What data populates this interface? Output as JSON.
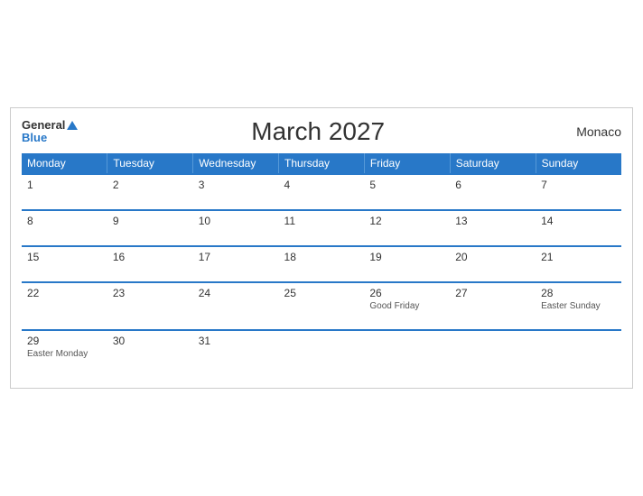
{
  "header": {
    "logo_general": "General",
    "logo_blue": "Blue",
    "title": "March 2027",
    "country": "Monaco"
  },
  "weekdays": [
    "Monday",
    "Tuesday",
    "Wednesday",
    "Thursday",
    "Friday",
    "Saturday",
    "Sunday"
  ],
  "weeks": [
    [
      {
        "day": "1",
        "event": ""
      },
      {
        "day": "2",
        "event": ""
      },
      {
        "day": "3",
        "event": ""
      },
      {
        "day": "4",
        "event": ""
      },
      {
        "day": "5",
        "event": ""
      },
      {
        "day": "6",
        "event": ""
      },
      {
        "day": "7",
        "event": ""
      }
    ],
    [
      {
        "day": "8",
        "event": ""
      },
      {
        "day": "9",
        "event": ""
      },
      {
        "day": "10",
        "event": ""
      },
      {
        "day": "11",
        "event": ""
      },
      {
        "day": "12",
        "event": ""
      },
      {
        "day": "13",
        "event": ""
      },
      {
        "day": "14",
        "event": ""
      }
    ],
    [
      {
        "day": "15",
        "event": ""
      },
      {
        "day": "16",
        "event": ""
      },
      {
        "day": "17",
        "event": ""
      },
      {
        "day": "18",
        "event": ""
      },
      {
        "day": "19",
        "event": ""
      },
      {
        "day": "20",
        "event": ""
      },
      {
        "day": "21",
        "event": ""
      }
    ],
    [
      {
        "day": "22",
        "event": ""
      },
      {
        "day": "23",
        "event": ""
      },
      {
        "day": "24",
        "event": ""
      },
      {
        "day": "25",
        "event": ""
      },
      {
        "day": "26",
        "event": "Good Friday"
      },
      {
        "day": "27",
        "event": ""
      },
      {
        "day": "28",
        "event": "Easter Sunday"
      }
    ],
    [
      {
        "day": "29",
        "event": "Easter Monday"
      },
      {
        "day": "30",
        "event": ""
      },
      {
        "day": "31",
        "event": ""
      },
      {
        "day": "",
        "event": ""
      },
      {
        "day": "",
        "event": ""
      },
      {
        "day": "",
        "event": ""
      },
      {
        "day": "",
        "event": ""
      }
    ]
  ]
}
